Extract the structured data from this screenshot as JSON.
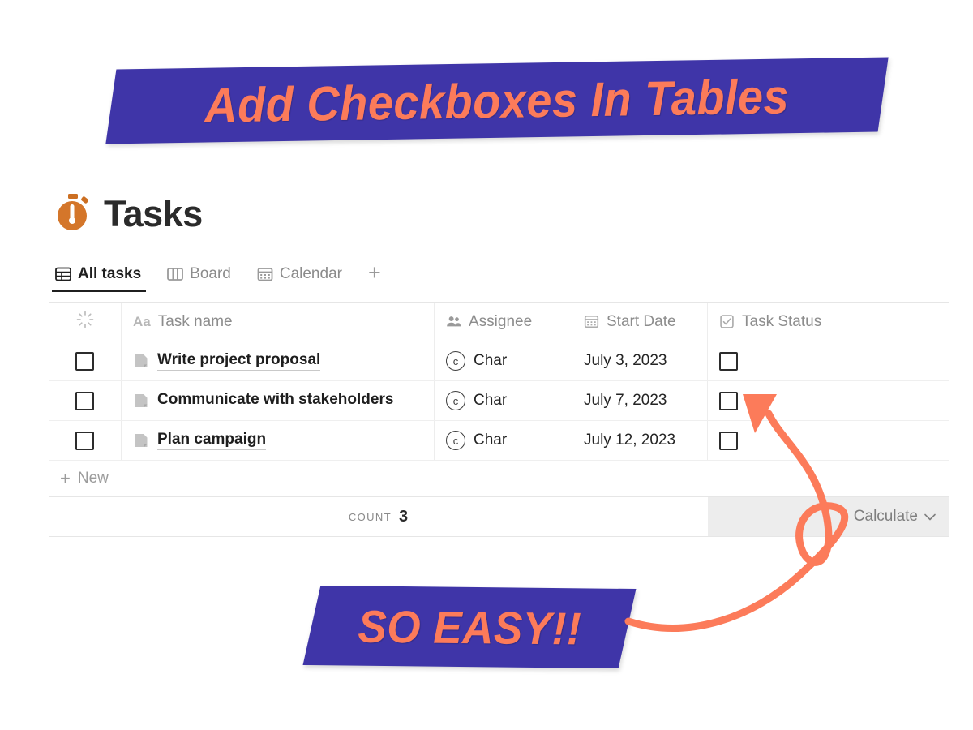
{
  "banners": {
    "title": "Add Checkboxes In Tables",
    "callout": "SO EASY!!",
    "purple": "#3F35A8",
    "orange": "#FC7B5A"
  },
  "page": {
    "icon": "stopwatch-icon",
    "title": "Tasks"
  },
  "tabs": {
    "items": [
      {
        "label": "All tasks",
        "icon": "table-grid-icon",
        "active": true
      },
      {
        "label": "Board",
        "icon": "board-columns-icon",
        "active": false
      },
      {
        "label": "Calendar",
        "icon": "calendar-icon",
        "active": false
      }
    ],
    "add_label": "+"
  },
  "table": {
    "columns": [
      {
        "label": "",
        "icon": "loading-spinner-icon"
      },
      {
        "label": "Task name",
        "icon": "aa-text-icon"
      },
      {
        "label": "Assignee",
        "icon": "people-icon"
      },
      {
        "label": "Start Date",
        "icon": "calendar-icon"
      },
      {
        "label": "Task Status",
        "icon": "checked-box-icon"
      }
    ],
    "rows": [
      {
        "selected": false,
        "name": "Write project proposal",
        "assignee": "Char",
        "avatar": "c",
        "date": "July 3, 2023",
        "status": false
      },
      {
        "selected": false,
        "name": "Communicate with stakeholders",
        "assignee": "Char",
        "avatar": "c",
        "date": "July 7, 2023",
        "status": false
      },
      {
        "selected": false,
        "name": "Plan campaign",
        "assignee": "Char",
        "avatar": "c",
        "date": "July 12, 2023",
        "status": false
      }
    ],
    "new_row_label": "New",
    "new_row_plus": "+",
    "footer": {
      "count_label": "COUNT",
      "count_value": "3",
      "calculate_label": "Calculate"
    }
  }
}
